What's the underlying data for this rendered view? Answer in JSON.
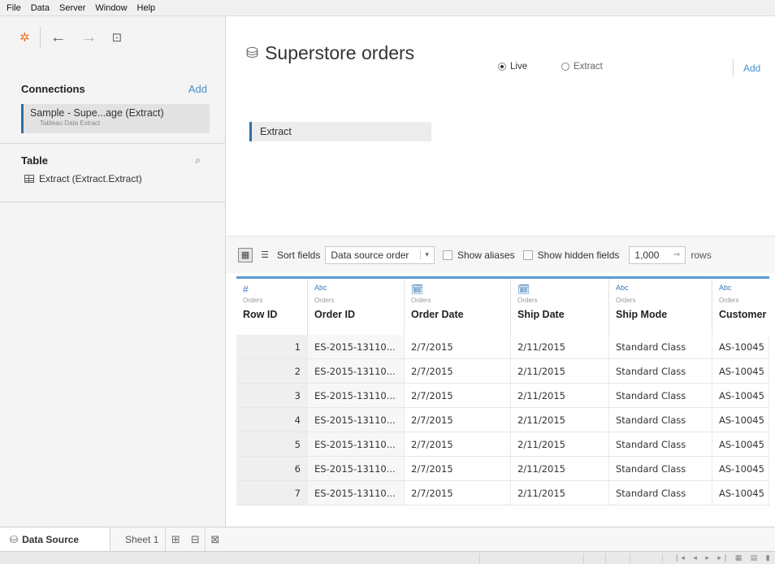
{
  "menu": [
    "File",
    "Data",
    "Server",
    "Window",
    "Help"
  ],
  "left_pane": {
    "connections_label": "Connections",
    "connections_add": "Add",
    "connection_name": "Sample - Supe...age (Extract)",
    "connection_type": "Tableau Data Extract",
    "table_label": "Table",
    "table_item": "Extract (Extract.Extract)"
  },
  "canvas": {
    "title": "Superstore orders",
    "connection_mode_live": "Live",
    "connection_mode_extract": "Extract",
    "selected_mode": "Live",
    "filters_add": "Add",
    "extract_table": "Extract"
  },
  "grid_toolbar": {
    "sort_label": "Sort fields",
    "sort_value": "Data source order",
    "show_aliases": "Show aliases",
    "show_hidden": "Show hidden fields",
    "rows_value": "1,000",
    "rows_label": "rows"
  },
  "columns": [
    {
      "type": "#",
      "source": "Orders",
      "name": "Row ID"
    },
    {
      "type": "Abc",
      "source": "Orders",
      "name": "Order ID"
    },
    {
      "type": "date",
      "source": "Orders",
      "name": "Order Date"
    },
    {
      "type": "date",
      "source": "Orders",
      "name": "Ship Date"
    },
    {
      "type": "Abc",
      "source": "Orders",
      "name": "Ship Mode"
    },
    {
      "type": "Abc",
      "source": "Orders",
      "name": "Customer I"
    }
  ],
  "rows": [
    [
      "1",
      "ES-2015-13110...",
      "2/7/2015",
      "2/11/2015",
      "Standard Class",
      "AS-10045"
    ],
    [
      "2",
      "ES-2015-13110...",
      "2/7/2015",
      "2/11/2015",
      "Standard Class",
      "AS-10045"
    ],
    [
      "3",
      "ES-2015-13110...",
      "2/7/2015",
      "2/11/2015",
      "Standard Class",
      "AS-10045"
    ],
    [
      "4",
      "ES-2015-13110...",
      "2/7/2015",
      "2/11/2015",
      "Standard Class",
      "AS-10045"
    ],
    [
      "5",
      "ES-2015-13110...",
      "2/7/2015",
      "2/11/2015",
      "Standard Class",
      "AS-10045"
    ],
    [
      "6",
      "ES-2015-13110...",
      "2/7/2015",
      "2/11/2015",
      "Standard Class",
      "AS-10045"
    ],
    [
      "7",
      "ES-2015-13110...",
      "2/7/2015",
      "2/11/2015",
      "Standard Class",
      "AS-10045"
    ]
  ],
  "tabs": {
    "data_source": "Data Source",
    "sheet1": "Sheet 1"
  },
  "colors": {
    "accent": "#2f6fa8",
    "link": "#4a8ec9",
    "header_bar": "#5b9bd5"
  }
}
